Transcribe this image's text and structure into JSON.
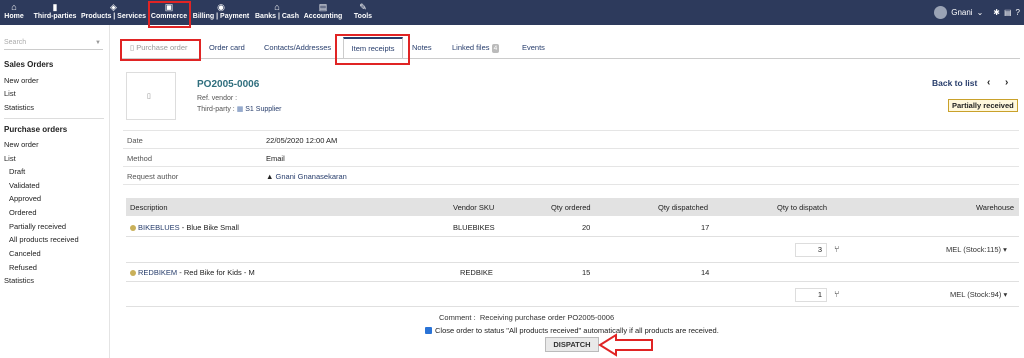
{
  "topmenu": {
    "items": [
      {
        "label": "Home",
        "icon": "home-icon"
      },
      {
        "label": "Third-parties",
        "icon": "building-icon"
      },
      {
        "label": "Products | Services",
        "icon": "cube-icon"
      },
      {
        "label": "Commerce",
        "icon": "briefcase-icon"
      },
      {
        "label": "Billing | Payment",
        "icon": "coins-icon"
      },
      {
        "label": "Banks | Cash",
        "icon": "bank-icon"
      },
      {
        "label": "Accounting",
        "icon": "ledger-icon"
      },
      {
        "label": "Tools",
        "icon": "wrench-icon"
      }
    ],
    "user": "Gnani",
    "user_caret": "⌄"
  },
  "sidebar": {
    "search_placeholder": "Search",
    "sales_heading": "Sales Orders",
    "sales_items": [
      "New order",
      "List",
      "Statistics"
    ],
    "purchase_heading": "Purchase orders",
    "purchase_items": [
      "New order",
      "List"
    ],
    "purchase_subitems": [
      "Draft",
      "Validated",
      "Approved",
      "Ordered",
      "Partially received",
      "All products received",
      "Canceled",
      "Refused"
    ],
    "purchase_statistics": "Statistics"
  },
  "tabs": {
    "purchase_order": "Purchase order",
    "order_card": "Order card",
    "contacts": "Contacts/Addresses",
    "item_receipts": "Item receipts",
    "notes": "Notes",
    "linked_files": "Linked files",
    "linked_files_count": "4",
    "events": "Events"
  },
  "order": {
    "ref": "PO2005-0006",
    "ref_vendor_label": "Ref. vendor :",
    "third_party_label": "Third-party :",
    "third_party": "S1 Supplier",
    "back_to_list": "Back to list",
    "prev": "‹",
    "next": "›",
    "status": "Partially received"
  },
  "fields": [
    {
      "label": "Date",
      "value": "22/05/2020 12:00 AM"
    },
    {
      "label": "Method",
      "value": "Email"
    },
    {
      "label": "Request author",
      "value": "Gnani Gnanasekaran"
    }
  ],
  "table": {
    "headers": {
      "description": "Description",
      "vendor_sku": "Vendor SKU",
      "qty_ordered": "Qty ordered",
      "qty_dispatched": "Qty dispatched",
      "qty_to_dispatch": "Qty to dispatch",
      "warehouse": "Warehouse"
    },
    "rows": [
      {
        "ref": "BIKEBLUES",
        "label": " - Blue Bike Small",
        "sku": "BLUEBIKES",
        "ordered": "20",
        "dispatched": "17",
        "to_dispatch": "3",
        "warehouse": "MEL (Stock:115)"
      },
      {
        "ref": "REDBIKEM",
        "label": " - Red Bike for Kids - M",
        "sku": "REDBIKE",
        "ordered": "15",
        "dispatched": "14",
        "to_dispatch": "1",
        "warehouse": "MEL (Stock:94)"
      }
    ]
  },
  "comment": {
    "label": "Comment :",
    "value": "Receiving purchase order PO2005-0006"
  },
  "close_order_text": "Close order to status \"All products received\" automatically if all products are received.",
  "dispatch_button": "DISPATCH",
  "colors": {
    "topbar": "#2d3a5c",
    "highlight": "#e02424",
    "link": "#263c6b",
    "badge_border": "#c9a12b"
  }
}
